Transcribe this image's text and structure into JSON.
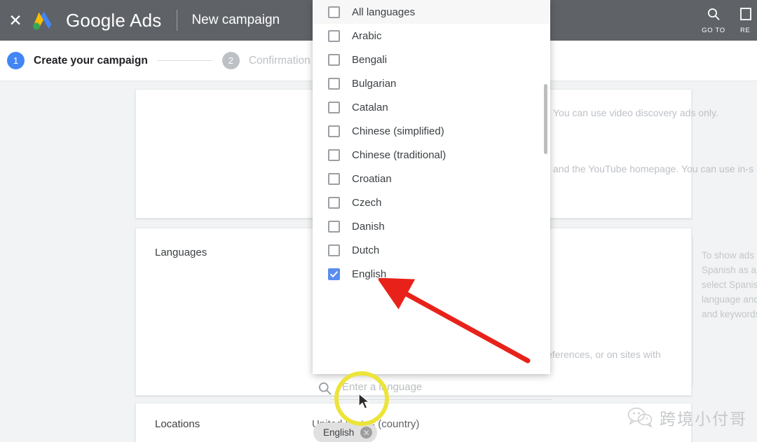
{
  "topbar": {
    "close_icon": "close-icon",
    "logo_icon": "google-ads-logo",
    "brand": "Google Ads",
    "page_title": "New campaign",
    "actions": [
      {
        "icon": "search-icon",
        "label": "GO TO"
      },
      {
        "icon": "reports-icon",
        "label": "RE"
      }
    ]
  },
  "stepper": {
    "steps": [
      {
        "num": "1",
        "label": "Create your campaign",
        "state": "active"
      },
      {
        "num": "2",
        "label": "Confirmation",
        "state": "inactive"
      }
    ]
  },
  "cards": {
    "networks_note_1": "You can use video discovery ads only.",
    "networks_note_2": "and the YouTube homepage. You can use in-s",
    "languages": {
      "label": "Languages",
      "inline_note": "eferences, or on sites with",
      "search_placeholder": "Enter a language",
      "search_icon": "search-icon",
      "selected_chips": [
        {
          "label": "English",
          "remove_icon": "close-icon"
        }
      ],
      "helper_lines": [
        "To show ads",
        "Spanish as a",
        "select Spanis",
        "language and",
        "and keywords"
      ]
    },
    "locations": {
      "label": "Locations",
      "value": "United States (country)"
    }
  },
  "dropdown": {
    "items": [
      {
        "label": "All languages",
        "checked": false
      },
      {
        "label": "Arabic",
        "checked": false
      },
      {
        "label": "Bengali",
        "checked": false
      },
      {
        "label": "Bulgarian",
        "checked": false
      },
      {
        "label": "Catalan",
        "checked": false
      },
      {
        "label": "Chinese (simplified)",
        "checked": false
      },
      {
        "label": "Chinese (traditional)",
        "checked": false
      },
      {
        "label": "Croatian",
        "checked": false
      },
      {
        "label": "Czech",
        "checked": false
      },
      {
        "label": "Danish",
        "checked": false
      },
      {
        "label": "Dutch",
        "checked": false
      },
      {
        "label": "English",
        "checked": true
      }
    ]
  },
  "annotations": {
    "arrow_color": "#e8221a",
    "highlight_color": "#ece43a",
    "cursor_icon": "mouse-pointer-icon"
  },
  "watermark": {
    "icon": "wechat-icon",
    "text": "跨境小付哥"
  },
  "colors": {
    "topbar_bg": "#5f6368",
    "accent_blue": "#4285f4",
    "checkbox_blue": "#5b8def",
    "page_bg": "#f1f3f4"
  }
}
